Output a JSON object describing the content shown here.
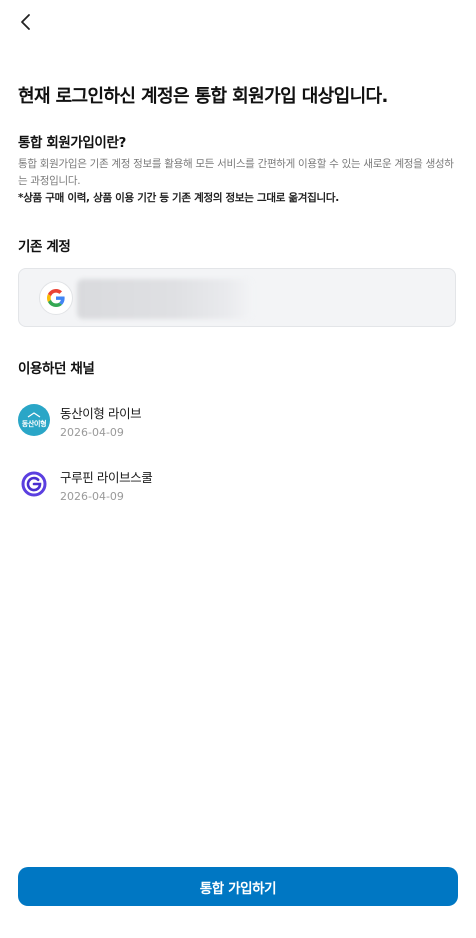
{
  "header": {
    "back_icon": "chevron-left-icon"
  },
  "title": "현재 로그인하신 계정은 통합 회원가입 대상입니다.",
  "intro": {
    "heading": "통합 회원가입이란?",
    "description": "통합 회원가입은 기존 계정 정보를 활용해 모든 서비스를 간편하게 이용할 수 있는 새로운 계정을 생성하는 과정입니다.",
    "note": "*상품 구매 이력, 상품 이용 기간 등 기존 계정의 정보는 그대로 옮겨집니다."
  },
  "existing_account": {
    "heading": "기존 계정",
    "provider_icon": "google-icon",
    "email_redacted": true
  },
  "channels": {
    "heading": "이용하던 채널",
    "items": [
      {
        "name": "동산이형 라이브",
        "date": "2026-04-09",
        "icon_text": "동산이형",
        "icon": "dongsan-channel-icon",
        "color": "#2aa6c7"
      },
      {
        "name": "구루핀 라이브스쿨",
        "date": "2026-04-09",
        "icon": "gurupin-channel-icon",
        "color": "#5b3fe0"
      }
    ]
  },
  "footer": {
    "join_label": "통합 가입하기"
  },
  "colors": {
    "primary": "#0077c3",
    "muted_text": "#7a7a7a",
    "card_bg": "#f3f4f6"
  }
}
